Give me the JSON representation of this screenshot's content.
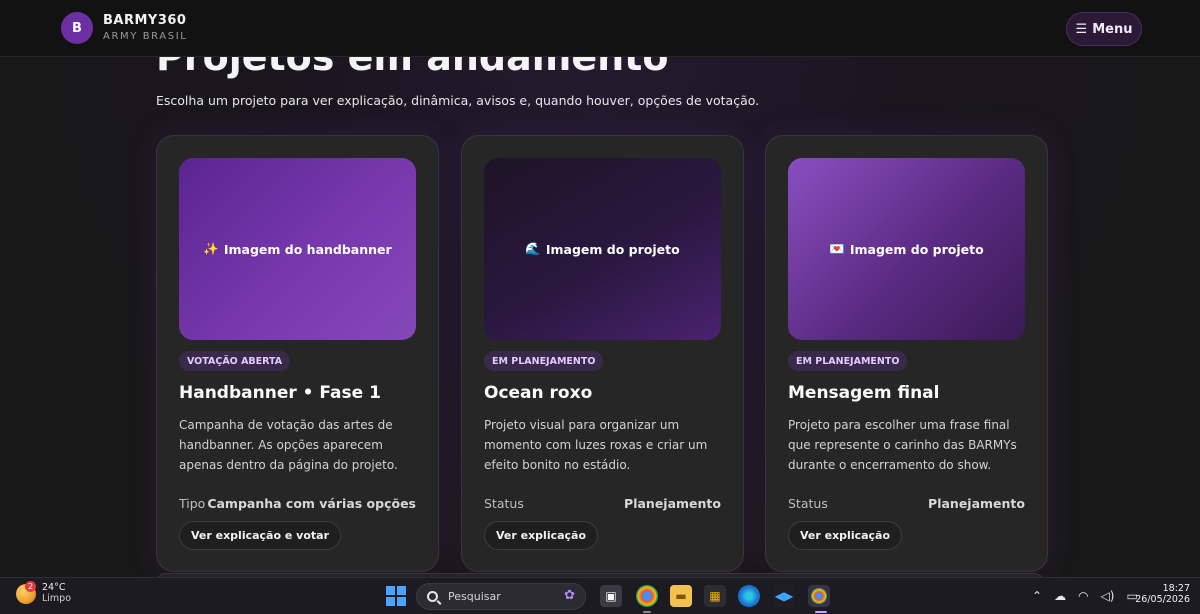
{
  "header": {
    "logo_letter": "B",
    "brand_name": "BARMY360",
    "brand_sub": "ARMY BRASIL",
    "menu_label": "Menu"
  },
  "hero": {
    "title": "Projetos em andamento",
    "subtitle": "Escolha um projeto para ver explicação, dinâmica, avisos e, quando houver, opções de votação."
  },
  "cards": [
    {
      "image_icon": "✨",
      "image_label": "Imagem do handbanner",
      "badge": "VOTAÇÃO ABERTA",
      "title": "Handbanner • Fase 1",
      "description": "Campanha de votação das artes de handbanner. As opções aparecem apenas dentro da página do projeto.",
      "meta_label": "Tipo",
      "meta_value": "Campanha com várias opções",
      "button": "Ver explicação e votar"
    },
    {
      "image_icon": "🌊",
      "image_label": "Imagem do projeto",
      "badge": "EM PLANEJAMENTO",
      "title": "Ocean roxo",
      "description": "Projeto visual para organizar um momento com luzes roxas e criar um efeito bonito no estádio.",
      "meta_label": "Status",
      "meta_value": "Planejamento",
      "button": "Ver explicação"
    },
    {
      "image_icon": "💌",
      "image_label": "Imagem do projeto",
      "badge": "EM PLANEJAMENTO",
      "title": "Mensagem final",
      "description": "Projeto para escolher uma frase final que represente o carinho das BARMYs durante o encerramento do show.",
      "meta_label": "Status",
      "meta_value": "Planejamento",
      "button": "Ver explicação"
    }
  ],
  "taskbar": {
    "weather_badge": "2",
    "weather_temp": "24°C",
    "weather_condition": "Limpo",
    "search_placeholder": "Pesquisar",
    "time": "18:27",
    "date": "26/05/2026"
  },
  "colors": {
    "accent": "#6b2fa3",
    "badge_text": "#e2c9ff",
    "card_bg": "#262626"
  }
}
